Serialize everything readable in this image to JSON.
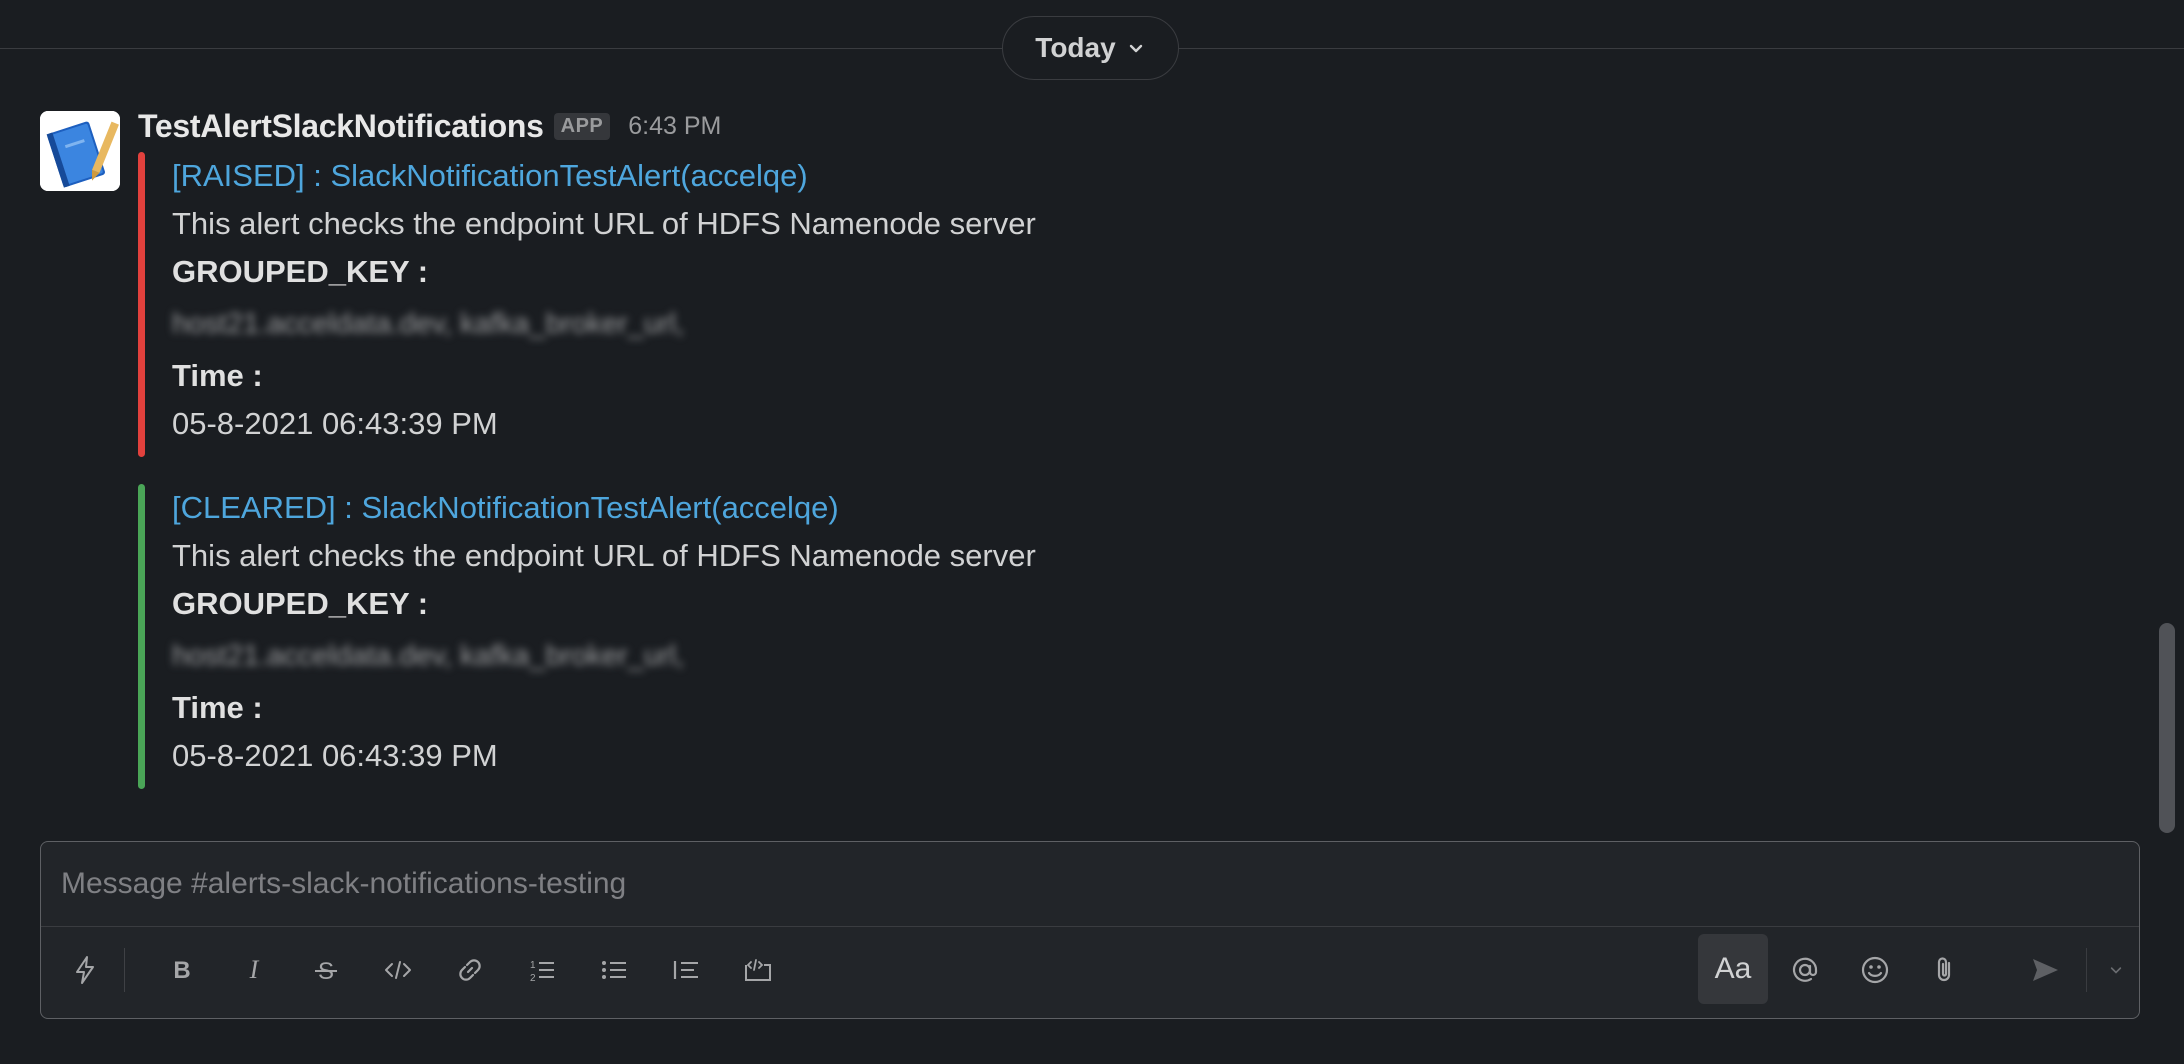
{
  "day_divider": {
    "label": "Today"
  },
  "message": {
    "sender": "TestAlertSlackNotifications",
    "badge": "APP",
    "time": "6:43 PM",
    "attachments": [
      {
        "status_color": "#e2413d",
        "title": "[RAISED] : SlackNotificationTestAlert(accelqe)",
        "description": "This alert checks the endpoint URL of HDFS Namenode server",
        "grouped_key_label": "GROUPED_KEY :",
        "grouped_key_value": "host21.acceldata.dev, kafka_broker_url,",
        "time_label": "Time :",
        "time_value": "05-8-2021 06:43:39 PM"
      },
      {
        "status_color": "#4aa557",
        "title": "[CLEARED] : SlackNotificationTestAlert(accelqe)",
        "description": "This alert checks the endpoint URL of HDFS Namenode server",
        "grouped_key_label": "GROUPED_KEY :",
        "grouped_key_value": "host21.acceldata.dev, kafka_broker_url,",
        "time_label": "Time :",
        "time_value": "05-8-2021 06:43:39 PM"
      }
    ]
  },
  "composer": {
    "placeholder": "Message #alerts-slack-notifications-testing",
    "format_label": "Aa",
    "toolbar_icons": [
      "shortcuts-icon",
      "bold-icon",
      "italic-icon",
      "strikethrough-icon",
      "code-icon",
      "link-icon",
      "ordered-list-icon",
      "bulleted-list-icon",
      "blockquote-icon",
      "code-block-icon",
      "mention-icon",
      "emoji-icon",
      "attach-icon",
      "send-icon",
      "schedule-chevron-icon"
    ]
  },
  "colors": {
    "background": "#1a1d21",
    "link": "#4ea6dd",
    "raised": "#e2413d",
    "cleared": "#4aa557"
  }
}
